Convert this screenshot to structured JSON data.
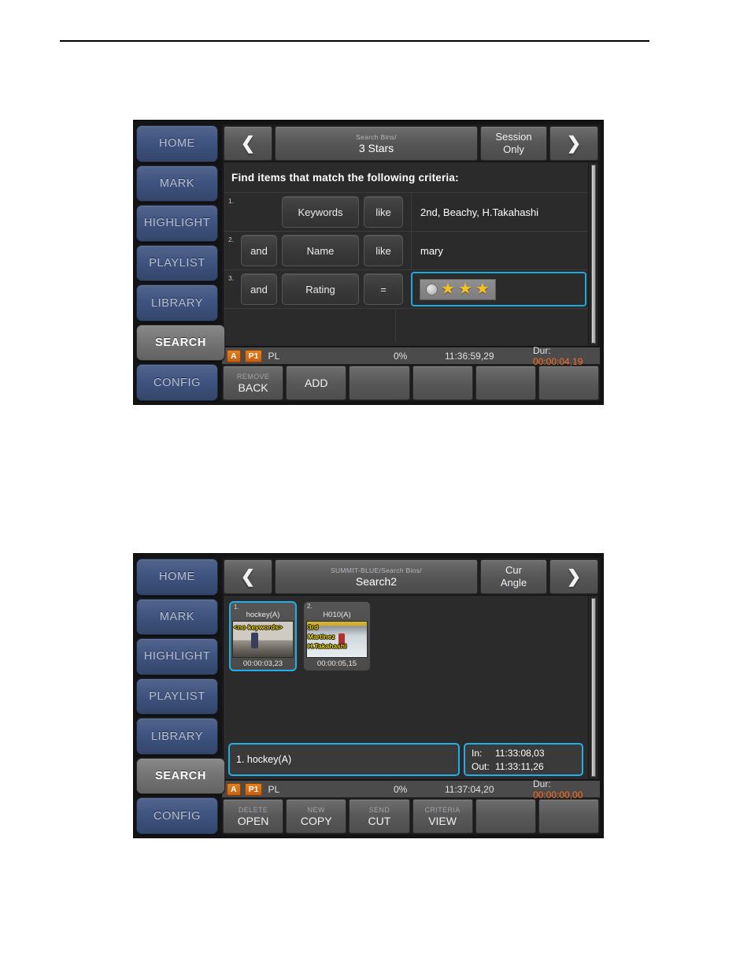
{
  "sidebar": {
    "items": [
      {
        "label": "HOME",
        "active": false
      },
      {
        "label": "MARK",
        "active": false
      },
      {
        "label": "HIGHLIGHT",
        "active": false
      },
      {
        "label": "PLAYLIST",
        "active": false
      },
      {
        "label": "LIBRARY",
        "active": false
      },
      {
        "label": "SEARCH",
        "active": true
      },
      {
        "label": "CONFIG",
        "active": false
      }
    ]
  },
  "colors": {
    "sidebar_blue": "#3f5480",
    "accent_cyan": "#22aee6",
    "badge_orange": "#d2701a",
    "duration_orange": "#ff6a1e",
    "star_yellow": "#f5c11e",
    "keyword_yellow": "#ffe400"
  },
  "panel1": {
    "topbar": {
      "prev_icon": "chevron-left-icon",
      "next_icon": "chevron-right-icon",
      "breadcrumb": "Search Bins/",
      "title": "3 Stars",
      "mode_line1": "Session",
      "mode_line2": "Only"
    },
    "criteria": {
      "heading": "Find items that match the following criteria:",
      "rows": [
        {
          "num": "1.",
          "conjunction": "",
          "field": "Keywords",
          "comparator": "like",
          "value": "2nd, Beachy, H.Takahashi",
          "selected": false,
          "value_type": "text"
        },
        {
          "num": "2.",
          "conjunction": "and",
          "field": "Name",
          "comparator": "like",
          "value": "mary",
          "selected": false,
          "value_type": "text"
        },
        {
          "num": "3.",
          "conjunction": "and",
          "field": "Rating",
          "comparator": "=",
          "value": "",
          "selected": true,
          "value_type": "stars",
          "stars": 3,
          "dot": true
        }
      ]
    },
    "status": {
      "badge_a": "A",
      "badge_p": "P1",
      "mode": "PL",
      "percent": "0%",
      "timecode": "11:36:59,29",
      "dur_label": "Dur:",
      "dur_value": "00:00:04,19"
    },
    "fkeys": [
      {
        "sub": "REMOVE",
        "main": "BACK"
      },
      {
        "sub": "",
        "main": "ADD"
      },
      {
        "sub": "",
        "main": ""
      },
      {
        "sub": "",
        "main": ""
      },
      {
        "sub": "",
        "main": ""
      },
      {
        "sub": "",
        "main": ""
      }
    ]
  },
  "panel2": {
    "topbar": {
      "prev_icon": "chevron-left-icon",
      "next_icon": "chevron-right-icon",
      "breadcrumb": "SUMMIT-BLUE/Search Bins/",
      "title": "Search2",
      "mode_line1": "Cur",
      "mode_line2": "Angle"
    },
    "thumbnails": [
      {
        "index": "1.",
        "name": "hockey(A)",
        "duration": "00:00:03,23",
        "selected": true,
        "keywords": [
          "<no keywords>"
        ],
        "art": "art1"
      },
      {
        "index": "2.",
        "name": "H010(A)",
        "duration": "00:00:05,15",
        "selected": false,
        "keywords": [
          "3rd",
          "Martinez",
          "H.Takahashi"
        ],
        "art": "art2"
      }
    ],
    "clip": {
      "name": "1. hockey(A)",
      "in_label": "In:",
      "in_value": "11:33:08,03",
      "out_label": "Out:",
      "out_value": "11:33:11,26"
    },
    "status": {
      "badge_a": "A",
      "badge_p": "P1",
      "mode": "PL",
      "percent": "0%",
      "timecode": "11:37:04,20",
      "dur_label": "Dur:",
      "dur_value": "00:00:00,00"
    },
    "fkeys": [
      {
        "sub": "DELETE",
        "main": "OPEN"
      },
      {
        "sub": "NEW",
        "main": "COPY"
      },
      {
        "sub": "SEND",
        "main": "CUT"
      },
      {
        "sub": "CRITERIA",
        "main": "VIEW"
      },
      {
        "sub": "",
        "main": ""
      },
      {
        "sub": "",
        "main": ""
      }
    ]
  }
}
